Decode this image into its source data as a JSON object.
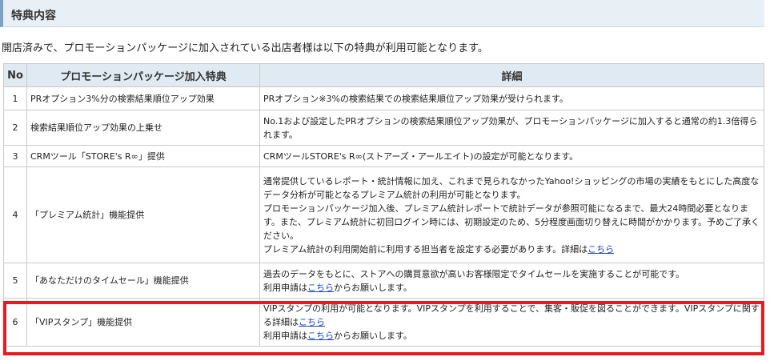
{
  "section_title": "特典内容",
  "intro": "開店済みで、プロモーションパッケージに加入されている出店者様は以下の特典が利用可能となります。",
  "table": {
    "headers": {
      "no": "No",
      "name": "プロモーションパッケージ加入特典",
      "detail": "詳細"
    },
    "rows": [
      {
        "no": "1",
        "name": "PRオプション3%分の検索結果順位アップ効果",
        "detail": [
          "PRオプション※3%の検索結果での検索結果順位アップ効果が受けられます。"
        ]
      },
      {
        "no": "2",
        "name": "検索結果順位アップ効果の上乗せ",
        "detail": [
          "No.1および設定したPRオプションの検索結果順位アップ効果が、プロモーションパッケージに加入すると通常の約1.3倍得られます。"
        ]
      },
      {
        "no": "3",
        "name": "CRMツール「STORE's R∞」提供",
        "detail": [
          "CRMツールSTORE's R∞(ストアーズ・アールエイト)の設定が可能となります。"
        ]
      },
      {
        "no": "4",
        "name": "「プレミアム統計」機能提供",
        "detail": [
          "通常提供しているレポート・統計情報に加え、これまで見られなかったYahoo!ショッピングの市場の実績をもとにした高度なデータ分析が可能となるプレミアム統計の利用が可能となります。",
          "プロモーションパッケージ加入後、プレミアム統計レポートで統計データが参照可能になるまで、最大24時間必要となります。また、プレミアム統計に初回ログイン時には、初期設定のため、5分程度画面切り替えに時間がかかります。予めご了承ください。"
        ],
        "detail_last_prefix": "プレミアム統計の利用開始前に利用する担当者を設定する必要があります。詳細は",
        "link": "こちら"
      },
      {
        "no": "5",
        "name": "「あなただけのタイムセール」機能提供",
        "detail": [
          "過去のデータをもとに、ストアへの購買意欲が高いお客様限定でタイムセールを実施することが可能です。"
        ],
        "apply_prefix": "利用申請は",
        "link": "こちら",
        "apply_suffix": "からお願いします。"
      },
      {
        "no": "6",
        "name": "「VIPスタンプ」機能提供",
        "detail": [
          "VIPスタンプの利用が可能となります。VIPスタンプを利用することで、集客・販促を図ることができます。VIPスタンプに関する詳細は"
        ],
        "link": "こちら",
        "apply_prefix": "利用申請は",
        "link2": "こちら",
        "apply_suffix": "からお願いします。"
      }
    ]
  },
  "colors": {
    "highlight": "#e8191f",
    "link": "#1a44c4",
    "header_bg": "#e0eaf2"
  }
}
